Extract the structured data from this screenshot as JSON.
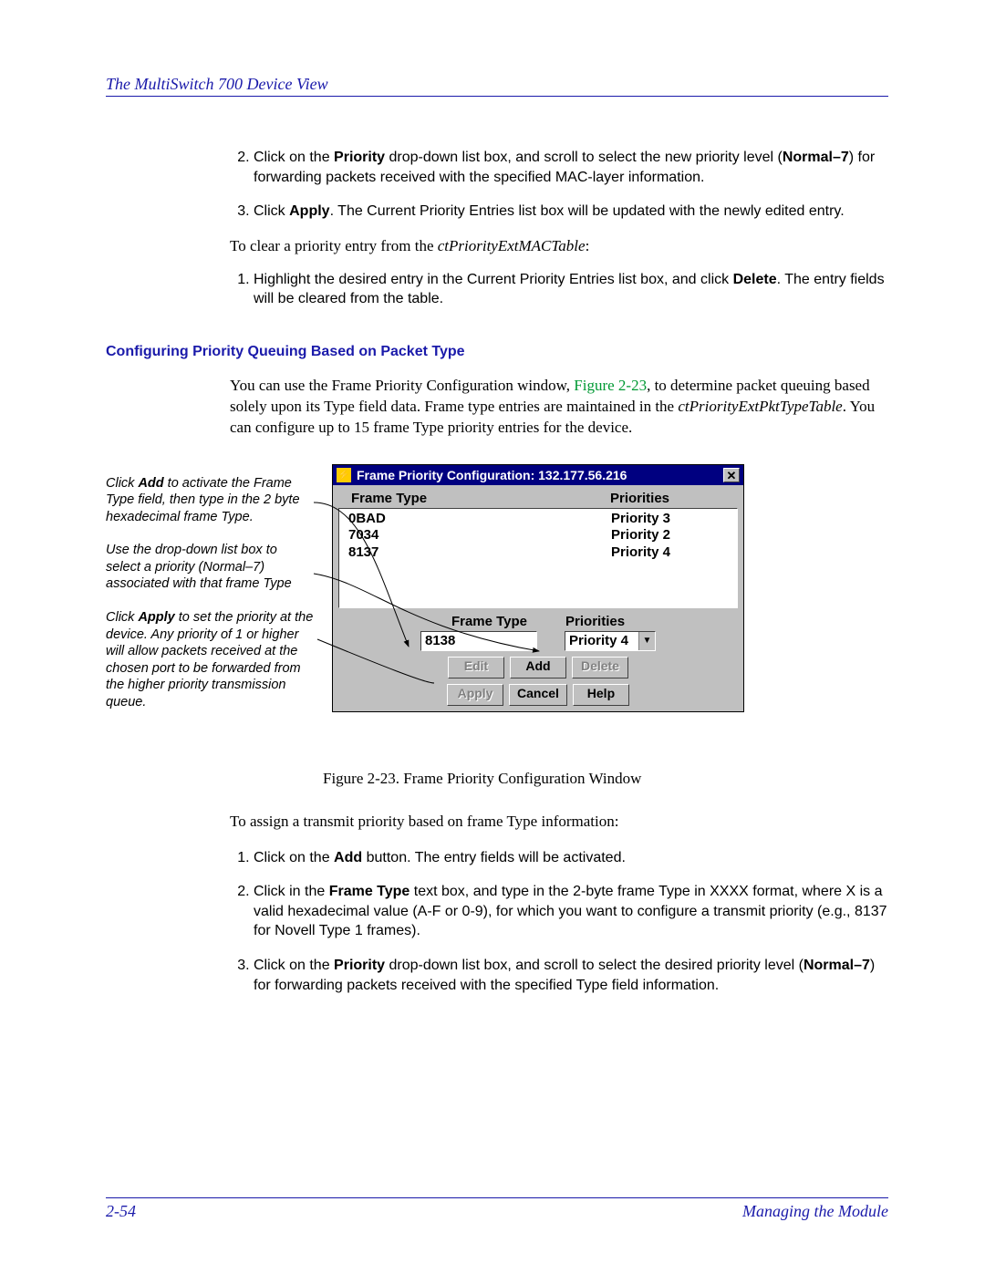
{
  "header": {
    "title": "The MultiSwitch 700 Device View"
  },
  "top_steps": {
    "s2_pre": "Click on the ",
    "s2_bold1": "Priority",
    "s2_mid": " drop-down list box, and scroll to select the new priority level (",
    "s2_bold2": "Normal–7",
    "s2_post": ") for forwarding packets received with the specified MAC-layer information.",
    "s3_pre": "Click ",
    "s3_bold": "Apply",
    "s3_post": ". The Current Priority Entries list box will be updated with the newly edited entry."
  },
  "clear_intro_pre": "To clear a priority entry from the ",
  "clear_intro_table": "ctPriorityExtMACTable",
  "clear_intro_post": ":",
  "clear_step1_pre": "Highlight the desired entry in the Current Priority Entries list box, and click ",
  "clear_step1_bold": "Delete",
  "clear_step1_post": ". The entry fields will be cleared from the table.",
  "section_heading": "Configuring Priority Queuing Based on Packet Type",
  "config_para_pre": "You can use the Frame Priority Configuration window, ",
  "config_para_link": "Figure 2-23",
  "config_para_mid": ", to determine packet queuing based solely upon its Type field data. Frame type entries are maintained in the ",
  "config_para_table": "ctPriorityExtPktTypeTable",
  "config_para_post": ". You can configure up to 15 frame Type priority entries for the device.",
  "annotation1_pre": "Click ",
  "annotation1_bold": "Add",
  "annotation1_post": " to activate the Frame Type field, then type in the 2 byte hexadecimal frame Type.",
  "annotation2": "Use the drop-down list box to select a priority (Normal–7) associated with that frame Type",
  "annotation3_pre": "Click ",
  "annotation3_bold": "Apply",
  "annotation3_post": " to set the priority at the device. Any priority of 1 or higher will allow packets received at the chosen port to be forwarded from the higher priority transmission queue.",
  "window": {
    "title": "Frame Priority Configuration: 132.177.56.216",
    "col1": "Frame Type",
    "col2": "Priorities",
    "rows": [
      {
        "type": "0BAD",
        "priority": "Priority 3"
      },
      {
        "type": "7034",
        "priority": "Priority 2"
      },
      {
        "type": "8137",
        "priority": "Priority 4"
      }
    ],
    "form_label1": "Frame Type",
    "form_label2": "Priorities",
    "input_value": "8138",
    "dropdown_value": "Priority 4",
    "buttons": {
      "edit": "Edit",
      "add": "Add",
      "delete": "Delete",
      "apply": "Apply",
      "cancel": "Cancel",
      "help": "Help"
    }
  },
  "figcaption": "Figure 2-23.  Frame Priority Configuration Window",
  "assign_intro": "To assign a transmit priority based on frame Type information:",
  "assign_steps": {
    "s1_pre": "Click on the ",
    "s1_bold": "Add",
    "s1_post": " button. The entry fields will be activated.",
    "s2_pre": "Click in the ",
    "s2_bold": "Frame Type",
    "s2_post": " text box, and type in the 2-byte frame Type in XXXX format, where X is a valid hexadecimal value (A-F or 0-9), for which you want to configure a transmit priority (e.g., 8137 for Novell Type 1 frames).",
    "s3_pre": "Click on the ",
    "s3_bold1": "Priority",
    "s3_mid": " drop-down list box, and scroll to select the desired priority level (",
    "s3_bold2": "Normal–7",
    "s3_post": ") for forwarding packets received with the specified Type field information."
  },
  "footer": {
    "pagenum": "2-54",
    "section": "Managing the Module"
  }
}
